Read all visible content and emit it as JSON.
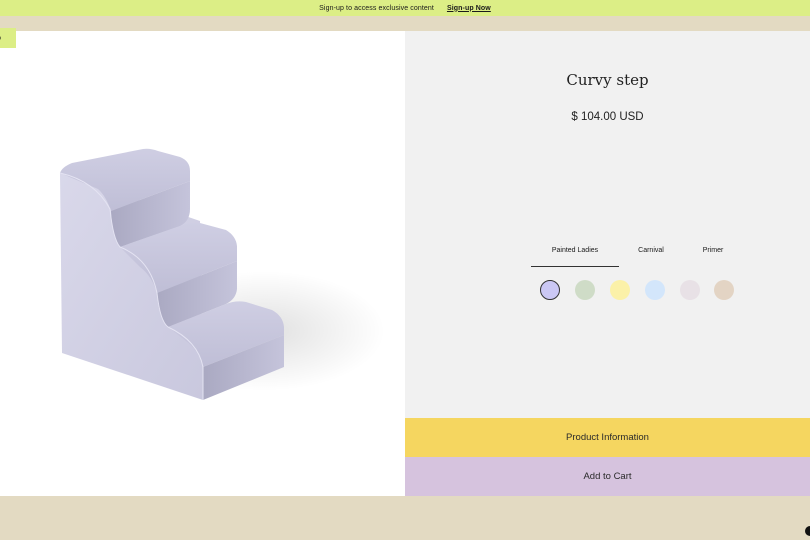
{
  "promo": {
    "text": "Sign-up to access exclusive content",
    "link_label": "Sign-up Now"
  },
  "left_tab": {
    "label": "p"
  },
  "product": {
    "title": "Curvy step",
    "price": "$ 104.00 USD",
    "image_icon": "stair-step-shape"
  },
  "collections": {
    "tabs": [
      {
        "label": "Painted Ladies",
        "selected": true
      },
      {
        "label": "Carnival",
        "selected": false
      },
      {
        "label": "Primer",
        "selected": false
      }
    ]
  },
  "swatches": [
    {
      "color": "#cbc8f4",
      "selected": true
    },
    {
      "color": "#cfdcc7",
      "selected": false
    },
    {
      "color": "#fbf1a8",
      "selected": false
    },
    {
      "color": "#d3e6fb",
      "selected": false
    },
    {
      "color": "#e8e1e6",
      "selected": false
    },
    {
      "color": "#e3d4c4",
      "selected": false
    }
  ],
  "actions": {
    "info_label": "Product Information",
    "cart_label": "Add to Cart"
  },
  "colors": {
    "promo_bg": "#dcee86",
    "page_bg": "#e3dac2",
    "info_button": "#f5d660",
    "cart_button": "#d6c3de"
  }
}
